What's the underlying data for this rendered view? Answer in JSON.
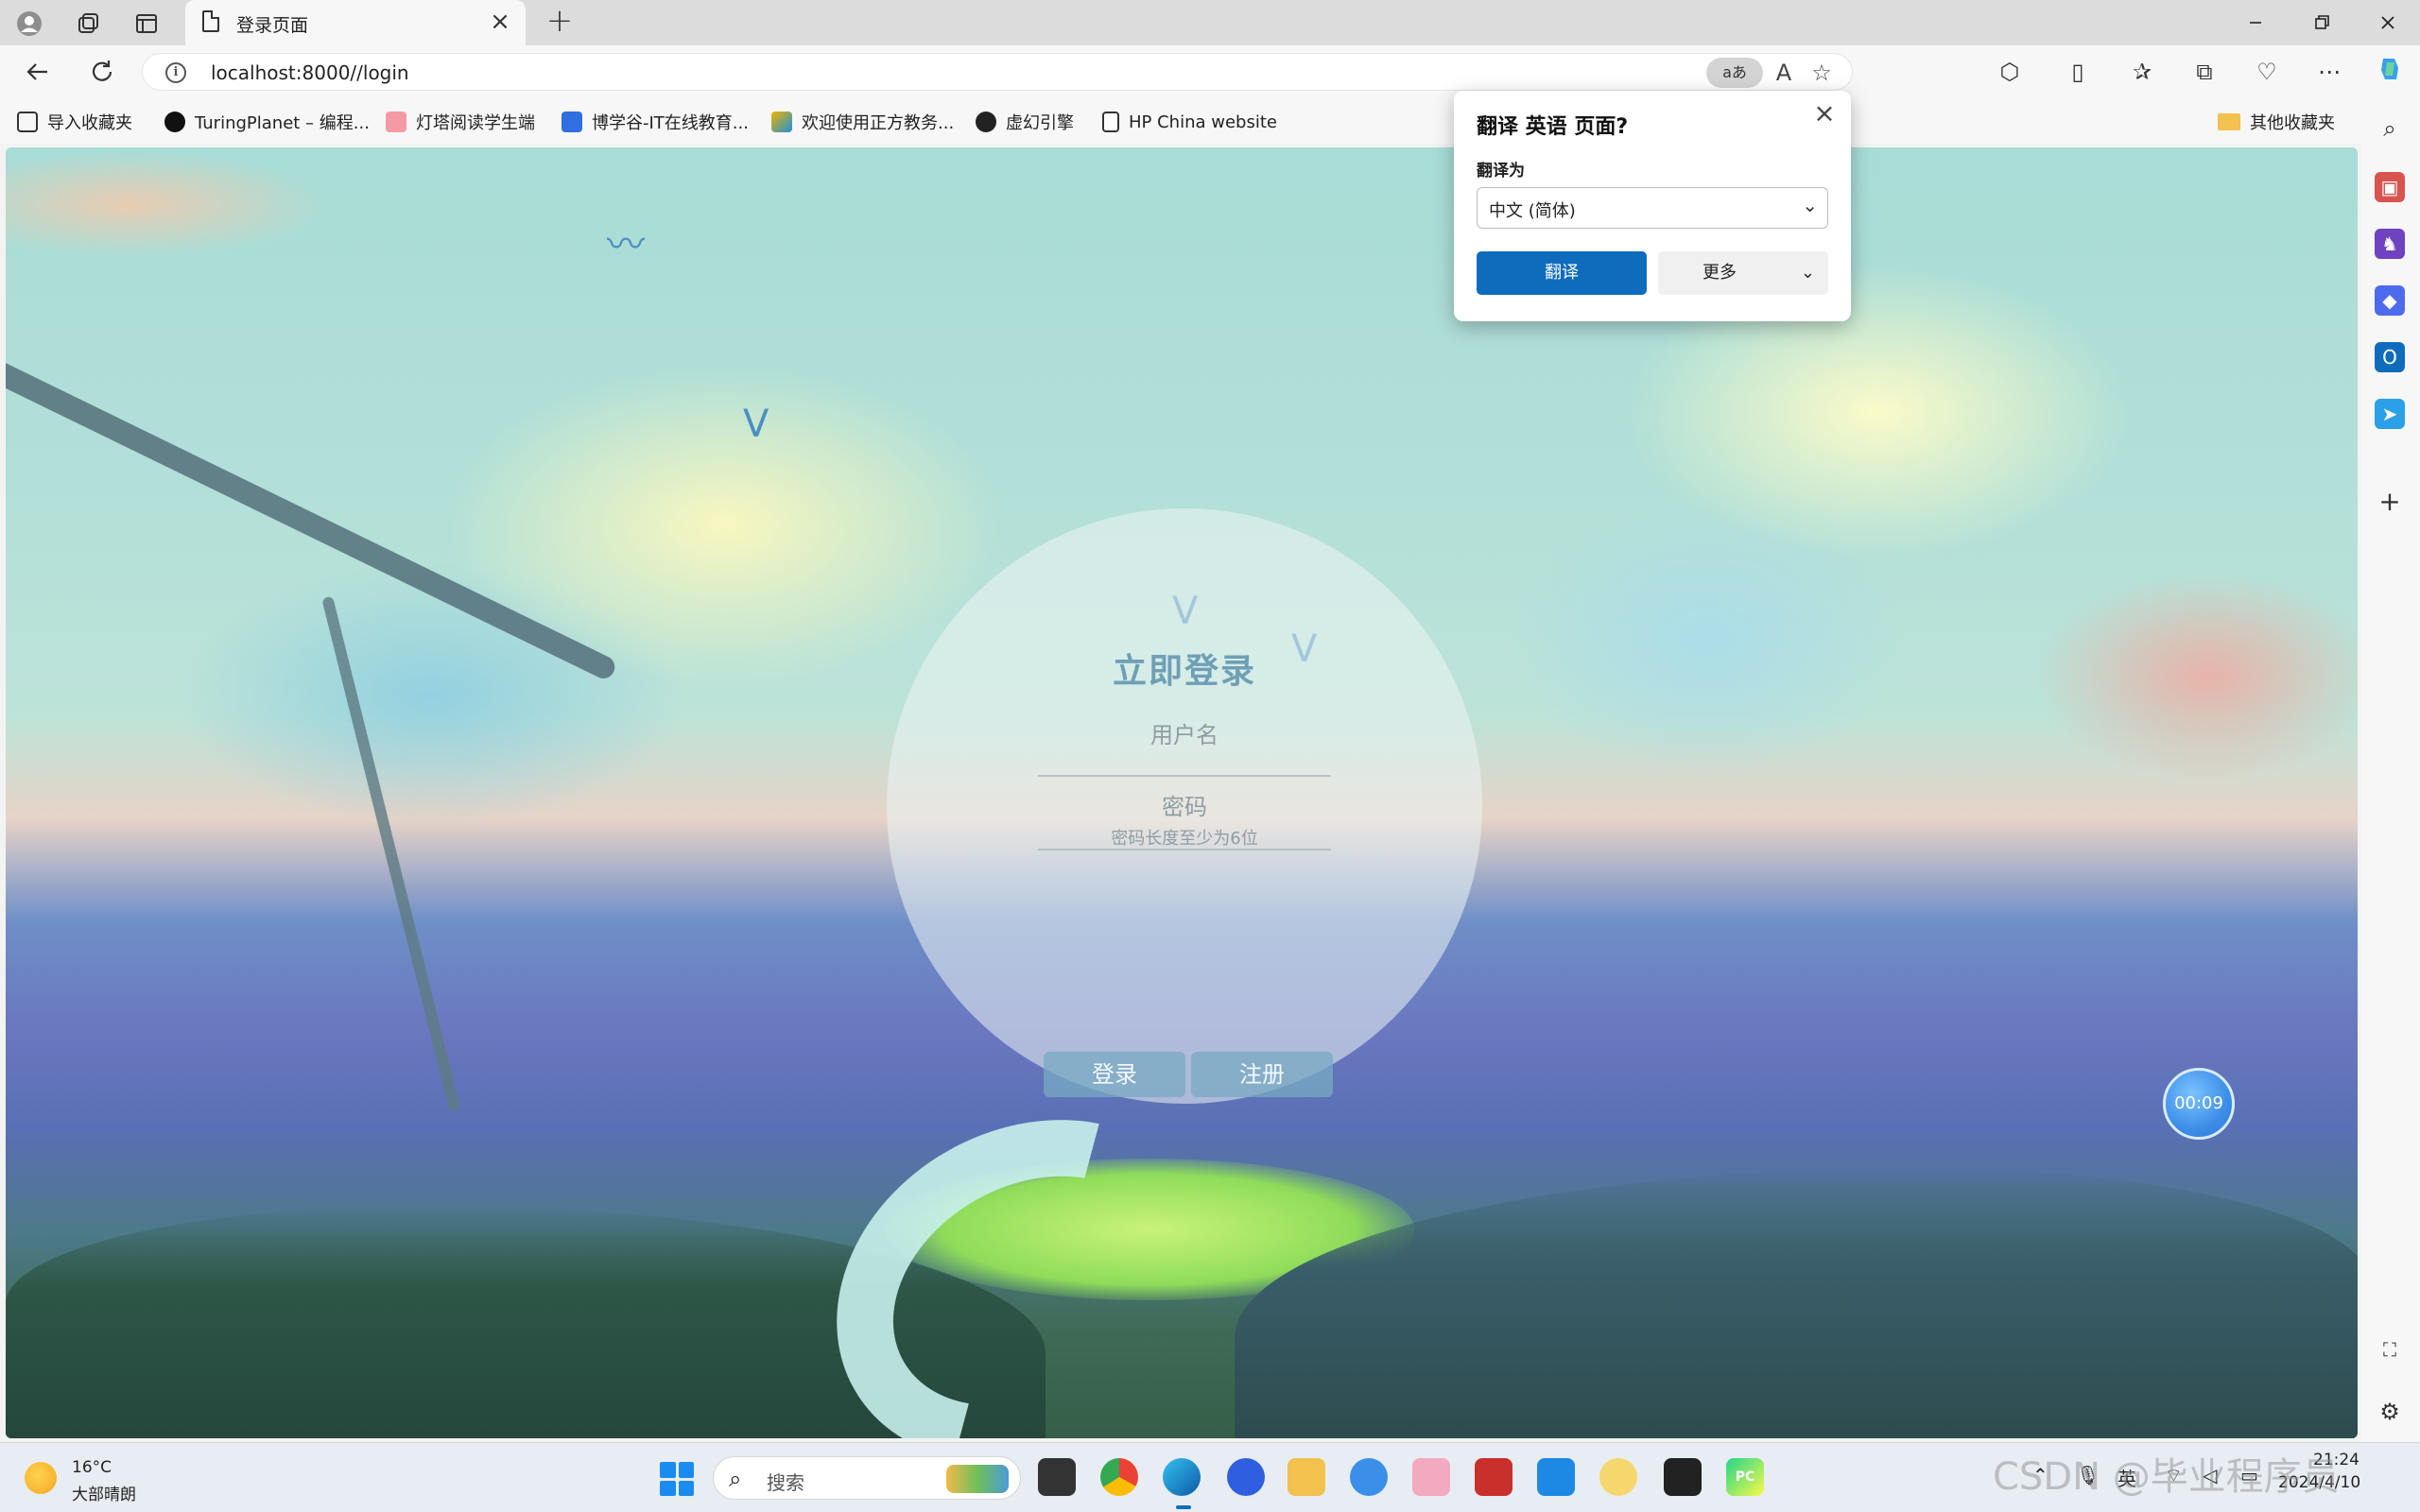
{
  "browser": {
    "tab_title": "登录页面",
    "url": "localhost:8000//login",
    "translate_chip": "aあ"
  },
  "bookmarks": [
    {
      "label": "导入收藏夹",
      "icon": "import-icon"
    },
    {
      "label": "TuringPlanet – 编程...",
      "icon": "turingplanet-icon"
    },
    {
      "label": "灯塔阅读学生端",
      "icon": "lighthouse-icon"
    },
    {
      "label": "博学谷-IT在线教育...",
      "icon": "boxuegu-icon"
    },
    {
      "label": "欢迎使用正方教务...",
      "icon": "zhengfang-icon"
    },
    {
      "label": "虚幻引擎",
      "icon": "unreal-icon"
    },
    {
      "label": "HP China website",
      "icon": "page-icon"
    }
  ],
  "other_bookmarks": "其他收藏夹",
  "translate_popup": {
    "title": "翻译 英语 页面?",
    "target_label": "翻译为",
    "target_value": "中文 (简体)",
    "translate_button": "翻译",
    "more_button": "更多"
  },
  "login": {
    "title": "立即登录",
    "username_placeholder": "用户名",
    "password_placeholder": "密码",
    "password_hint": "密码长度至少为6位",
    "login_button": "登录",
    "register_button": "注册"
  },
  "timer": "00:09",
  "taskbar": {
    "temperature": "16°C",
    "weather": "大部晴朗",
    "search_placeholder": "搜索",
    "input_method": "英",
    "time": "21:24",
    "date": "2024/4/10"
  },
  "watermark": "CSDN @毕业程序员",
  "colors": {
    "accent": "#0f6cbd",
    "login_button": "#78aac3",
    "login_title": "#6e9fb5"
  }
}
